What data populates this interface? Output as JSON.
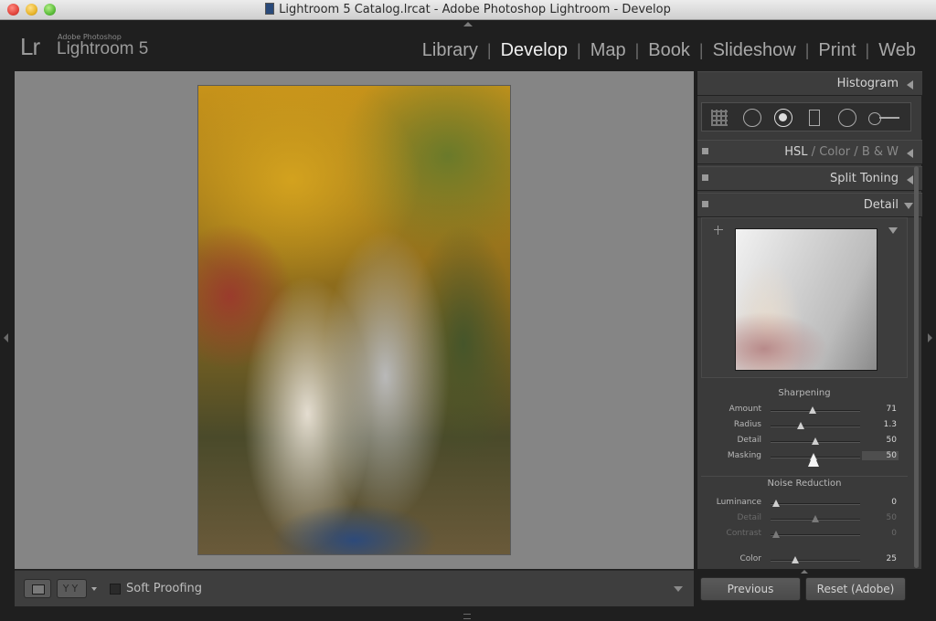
{
  "window": {
    "title": "Lightroom 5 Catalog.lrcat - Adobe Photoshop Lightroom - Develop"
  },
  "identity": {
    "logo": "Lr",
    "sub": "Adobe Photoshop",
    "name": "Lightroom 5"
  },
  "modules": [
    {
      "label": "Library"
    },
    {
      "label": "Develop",
      "active": true
    },
    {
      "label": "Map"
    },
    {
      "label": "Book"
    },
    {
      "label": "Slideshow"
    },
    {
      "label": "Print"
    },
    {
      "label": "Web"
    }
  ],
  "panels": {
    "histogram": "Histogram",
    "hsl": {
      "hsl": "HSL",
      "color": "Color",
      "bw": "B & W",
      "sep": "/"
    },
    "split_toning": "Split Toning",
    "detail": "Detail"
  },
  "sharpening": {
    "title": "Sharpening",
    "sliders": [
      {
        "label": "Amount",
        "value": "71",
        "position": 0.47
      },
      {
        "label": "Radius",
        "value": "1.3",
        "position": 0.34
      },
      {
        "label": "Detail",
        "value": "50",
        "position": 0.5
      },
      {
        "label": "Masking",
        "value": "50",
        "position": 0.48
      }
    ]
  },
  "noise_reduction": {
    "title": "Noise Reduction",
    "sliders": [
      {
        "label": "Luminance",
        "value": "0",
        "position": 0.06,
        "dim": false
      },
      {
        "label": "Detail",
        "value": "50",
        "position": 0.5,
        "dim": true
      },
      {
        "label": "Contrast",
        "value": "0",
        "position": 0.06,
        "dim": true
      },
      {
        "label": "Color",
        "value": "25",
        "position": 0.28,
        "dim": false
      }
    ]
  },
  "toolbar": {
    "yy": "YY",
    "soft_proofing": "Soft Proofing"
  },
  "buttons": {
    "previous": "Previous",
    "reset": "Reset (Adobe)"
  }
}
